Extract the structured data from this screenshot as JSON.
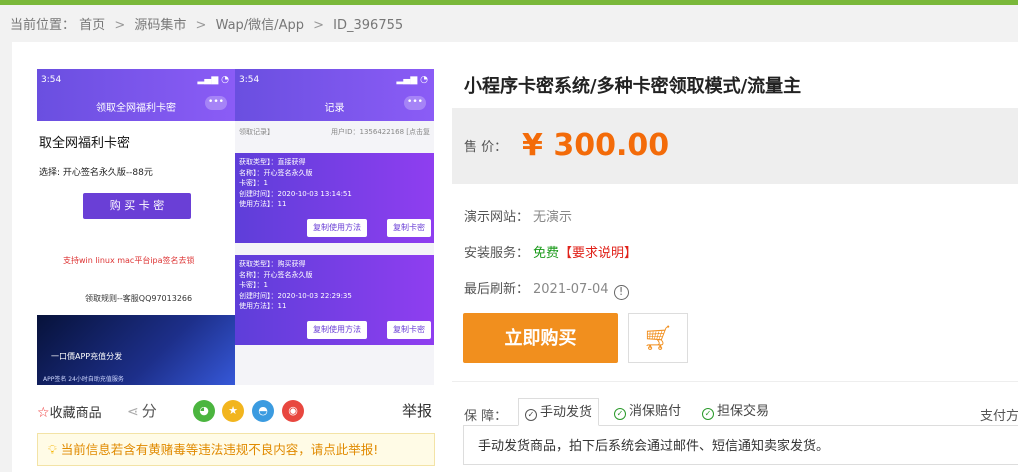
{
  "breadcrumb": {
    "prefix": "当前位置：",
    "items": [
      "首页",
      "源码集市",
      "Wap/微信/App",
      "ID_396755"
    ],
    "separator": ">"
  },
  "product": {
    "title": "小程序卡密系统/多种卡密领取模式/流量主",
    "price_label": "售  价：",
    "price": "¥ 300.00",
    "demo_label": "演示网站：",
    "demo_value": "无演示",
    "install_label": "安装服务：",
    "install_value": "免费",
    "install_req": "【要求说明】",
    "refresh_label": "最后刷新：",
    "refresh_value": "2021-07-04",
    "buy_label": "立即购买"
  },
  "guarantee": {
    "label": "保  障：",
    "tabs": [
      "手动发货",
      "消保赔付",
      "担保交易"
    ],
    "pay_label": "支付方",
    "description": "手动发货商品，拍下后系统会通过邮件、短信通知卖家发货。"
  },
  "actions": {
    "favorite": "收藏商品",
    "share": "分",
    "report": "举报"
  },
  "notice": "当前信息若含有黄赌毒等违法违规不良内容，请点此举报!",
  "preview": {
    "left": {
      "time": "3:54",
      "header": "领取全网福利卡密",
      "title": "取全网福利卡密",
      "pick": "选择: 开心签名永久版--88元",
      "buy": "购 买 卡 密",
      "red": "支持win linux mac平台ipa签名去锁",
      "contact": "领取规则--客服QQ97013266",
      "banner1": "一口價APP充值分发",
      "banner2": "APP签名 24小时自助充值服务"
    },
    "right": {
      "time": "3:54",
      "header": "记录",
      "id_left": "领取记录】",
      "id_right": "用户ID：1356422168 [点击复",
      "records": [
        {
          "lines": [
            "获取类型】：直接获得",
            "名称】：开心签名永久版",
            "卡密】：1",
            "创建时间】：2020-10-03 13:14:51",
            "使用方法】：11"
          ]
        },
        {
          "lines": [
            "获取类型】：购买获得",
            "名称】：开心签名永久版",
            "卡密】：1",
            "创建时间】：2020-10-03 22:29:35",
            "使用方法】：11"
          ]
        }
      ],
      "btn_use": "复制使用方法",
      "btn_code": "复制卡密"
    }
  },
  "colors": {
    "accent_orange": "#f18f1e",
    "price": "#f36b09",
    "top_bar": "#7ab83a"
  }
}
